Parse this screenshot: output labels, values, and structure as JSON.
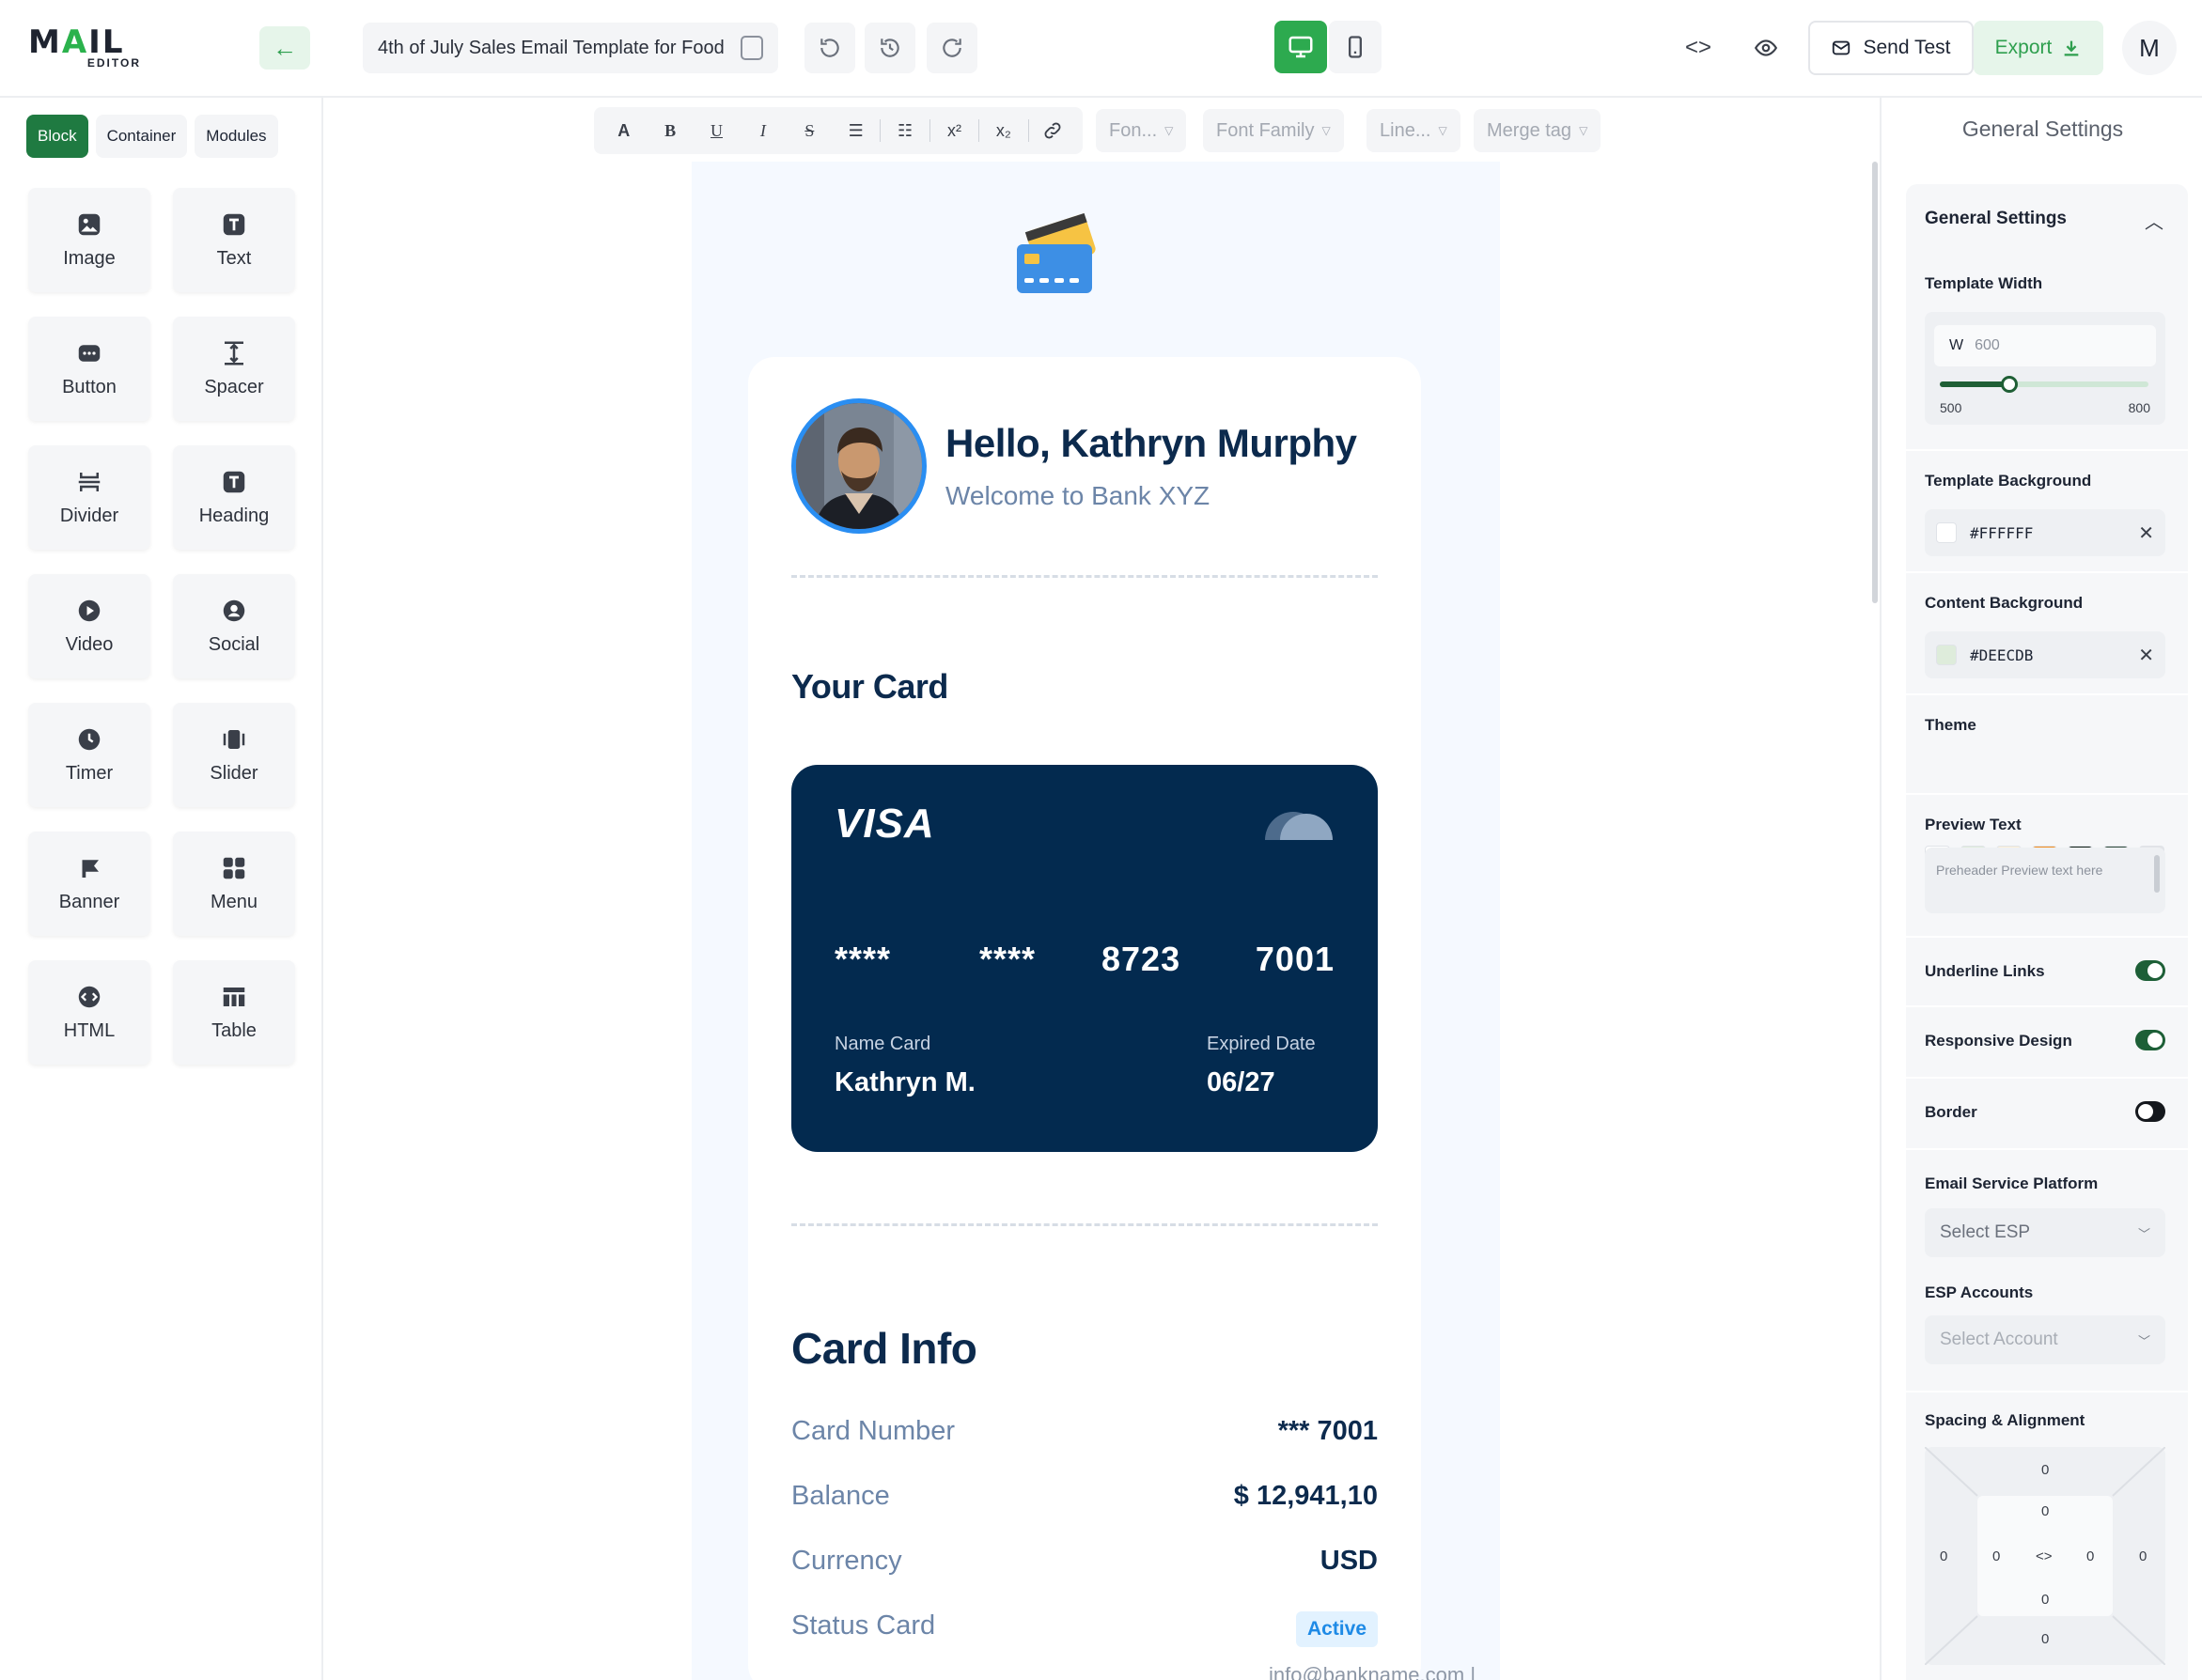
{
  "app": {
    "logo_main": "MAIL",
    "logo_sub": "EDITOR",
    "doc_title": "4th of July Sales Email Template for Food",
    "send_test": "Send Test",
    "export": "Export",
    "user_initial": "M"
  },
  "left_panel": {
    "tabs": [
      "Block",
      "Container",
      "Modules"
    ],
    "blocks": [
      {
        "label": "Image",
        "icon": "image-icon"
      },
      {
        "label": "Text",
        "icon": "text-icon"
      },
      {
        "label": "Button",
        "icon": "button-icon"
      },
      {
        "label": "Spacer",
        "icon": "spacer-icon"
      },
      {
        "label": "Divider",
        "icon": "divider-icon"
      },
      {
        "label": "Heading",
        "icon": "heading-icon"
      },
      {
        "label": "Video",
        "icon": "video-icon"
      },
      {
        "label": "Social",
        "icon": "social-icon"
      },
      {
        "label": "Timer",
        "icon": "timer-icon"
      },
      {
        "label": "Slider",
        "icon": "slider-icon"
      },
      {
        "label": "Banner",
        "icon": "banner-icon"
      },
      {
        "label": "Menu",
        "icon": "menu-icon"
      },
      {
        "label": "HTML",
        "icon": "html-icon"
      },
      {
        "label": "Table",
        "icon": "table-icon"
      }
    ]
  },
  "toolbar": {
    "font_size": "Fon...",
    "font_family": "Font Family",
    "line_height": "Line...",
    "merge_tag": "Merge tag"
  },
  "email": {
    "hello": "Hello, Kathryn Murphy",
    "welcome": "Welcome to Bank XYZ",
    "your_card": "Your Card",
    "card_brand": "VISA",
    "card_groups": [
      "****",
      "****",
      "8723",
      "7001"
    ],
    "name_label": "Name Card",
    "name_value": "Kathryn M.",
    "expiry_label": "Expired Date",
    "expiry_value": "06/27",
    "card_info_title": "Card Info",
    "rows": [
      {
        "label": "Card Number",
        "value": "*** 7001"
      },
      {
        "label": "Balance",
        "value": "$ 12,941,10"
      },
      {
        "label": "Currency",
        "value": "USD"
      },
      {
        "label": "Status Card",
        "value": "Active"
      }
    ],
    "footer_partial": "info@bankname.com | www.website.com"
  },
  "settings": {
    "panel_title": "General Settings",
    "section_title": "General Settings",
    "template_width_label": "Template Width",
    "width_prefix": "W",
    "width_value": "600",
    "width_min": "500",
    "width_max": "800",
    "width_fraction": 0.333,
    "template_bg_label": "Template Background",
    "template_bg_value": "#FFFFFF",
    "content_bg_label": "Content Background",
    "content_bg_value": "#DEECDB",
    "theme_label": "Theme",
    "theme_colors": [
      "#FFFFFF",
      "#DEECDB",
      "#FDF1D6",
      "#F28C1C",
      "#0F1F17",
      "#2E4A3B",
      "#E2E4E7"
    ],
    "preview_label": "Preview Text",
    "preview_placeholder": "Preheader Preview text here",
    "underline_label": "Underline Links",
    "underline_on": true,
    "responsive_label": "Responsive Design",
    "responsive_on": true,
    "border_label": "Border",
    "border_on": false,
    "esp_label": "Email Service Platform",
    "esp_value": "Select ESP",
    "accounts_label": "ESP Accounts",
    "accounts_value": "Select Account",
    "spacing_label": "Spacing & Alignment",
    "spacing": {
      "m_top": "0",
      "p_top": "0",
      "m_left": "0",
      "p_left": "0",
      "link": "<>",
      "p_right": "0",
      "m_right": "0",
      "p_bottom": "0",
      "m_bottom": "0"
    }
  },
  "colors": {
    "accent": "#2DAA4F",
    "card_navy": "#032A4F",
    "heading_navy": "#0C2A4D"
  }
}
